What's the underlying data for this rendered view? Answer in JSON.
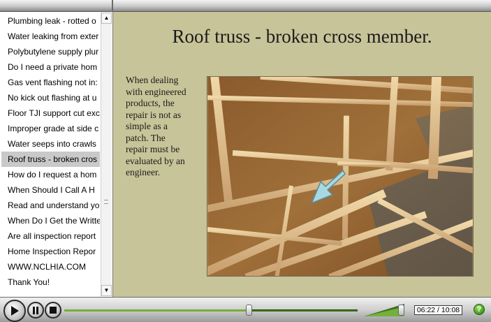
{
  "sidebar": {
    "items": [
      {
        "label": "Plumbing leak - rotted o",
        "selected": false
      },
      {
        "label": "Water leaking from exter",
        "selected": false
      },
      {
        "label": "Polybutylene supply plur",
        "selected": false
      },
      {
        "label": "Do I need a private hom",
        "selected": false
      },
      {
        "label": "Gas vent flashing not in:",
        "selected": false
      },
      {
        "label": "No kick out flashing at u",
        "selected": false
      },
      {
        "label": "Floor TJI support cut exc",
        "selected": false
      },
      {
        "label": "Improper grade at side c",
        "selected": false
      },
      {
        "label": "Water seeps into crawls",
        "selected": false
      },
      {
        "label": "Roof truss - broken cros",
        "selected": true
      },
      {
        "label": "How do I request a hom",
        "selected": false
      },
      {
        "label": "When Should I Call A H",
        "selected": false
      },
      {
        "label": "Read and understand yo",
        "selected": false
      },
      {
        "label": "When Do I Get the Writte",
        "selected": false
      },
      {
        "label": "Are all inspection report",
        "selected": false
      },
      {
        "label": "Home Inspection Repor",
        "selected": false
      },
      {
        "label": "WWW.NCLHIA.COM",
        "selected": false
      },
      {
        "label": "Thank You!",
        "selected": false
      }
    ],
    "scroll_up": "▲",
    "scroll_down": "▼"
  },
  "slide": {
    "title": "Roof truss - broken cross member.",
    "body_lines": [
      "When dealing",
      "with engineered",
      "products, the",
      "repair is not as",
      "simple as a",
      "patch.  The",
      "repair must be",
      "evaluated by an",
      "engineer."
    ],
    "photo_icon": "roof-truss-photo"
  },
  "player": {
    "time_display": "06:22 / 10:08",
    "progress_fraction": 0.63,
    "volume_fraction": 0.95,
    "help_label": "?"
  },
  "colors": {
    "slide_background": "#c8c499",
    "selected_item": "#c9c9c9",
    "progress_green": "#74b03a",
    "help_green": "#3f9a1a"
  }
}
